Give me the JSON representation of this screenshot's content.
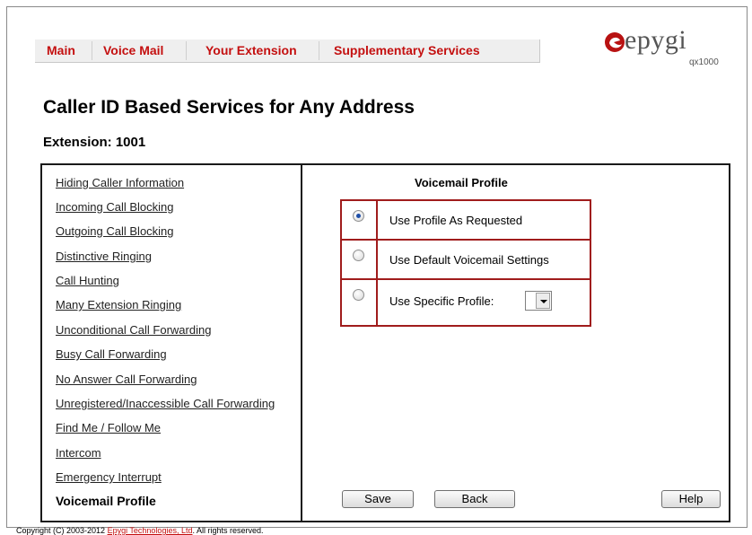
{
  "nav": {
    "items": [
      "Main",
      "Voice Mail",
      "Your Extension",
      "Supplementary Services"
    ]
  },
  "logo": {
    "word": "epygi",
    "model": "qx1000"
  },
  "page": {
    "title": "Caller ID Based Services for Any Address",
    "extension": "Extension: 1001"
  },
  "sidebar": {
    "items": [
      "Hiding Caller Information",
      "Incoming Call Blocking",
      "Outgoing Call Blocking",
      "Distinctive Ringing",
      "Call Hunting",
      "Many Extension Ringing",
      "Unconditional Call Forwarding",
      "Busy Call Forwarding",
      "No Answer Call Forwarding",
      "Unregistered/Inaccessible Call Forwarding",
      "Find Me / Follow Me",
      "Intercom",
      "Emergency Interrupt",
      "Voicemail Profile"
    ],
    "active": "Voicemail Profile"
  },
  "voicemail": {
    "section_title": "Voicemail Profile",
    "options": [
      {
        "label": "Use Profile As Requested",
        "selected": true
      },
      {
        "label": "Use Default Voicemail Settings",
        "selected": false
      },
      {
        "label": "Use Specific Profile:",
        "selected": false
      }
    ],
    "specific_profile_value": ""
  },
  "buttons": {
    "save": "Save",
    "back": "Back",
    "help": "Help"
  },
  "footer": {
    "prefix": "Copyright (C) 2003-2012 ",
    "company": "Epygi Technologies, Ltd",
    "suffix": ". All rights reserved."
  },
  "colors": {
    "accent": "#c41010",
    "border_red": "#a01c1c",
    "radio_dot": "#1f4fa8"
  }
}
